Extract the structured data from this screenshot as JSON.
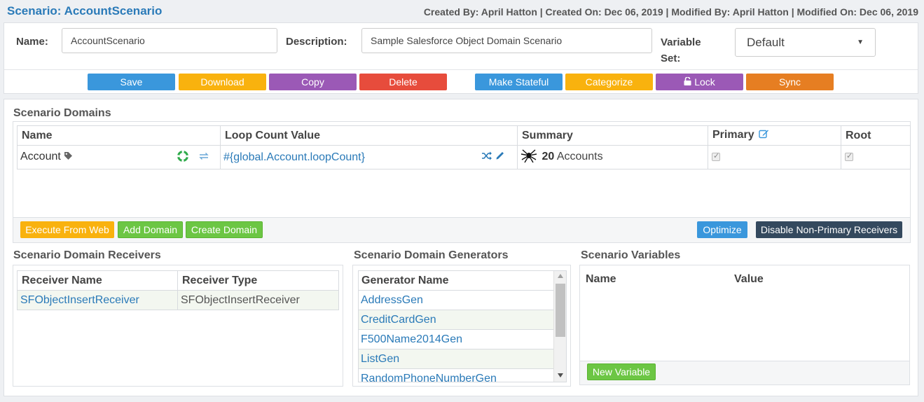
{
  "header": {
    "title": "Scenario: AccountScenario",
    "meta": "Created By: April Hatton | Created On: Dec 06, 2019 | Modified By: April Hatton | Modified On: Dec 06, 2019"
  },
  "form": {
    "name_label": "Name:",
    "name_value": "AccountScenario",
    "description_label": "Description:",
    "description_value": "Sample Salesforce Object Domain Scenario",
    "variable_set_label_1": "Variable",
    "variable_set_label_2": "Set:",
    "variable_set_value": "Default"
  },
  "toolbar": {
    "save": "Save",
    "download": "Download",
    "copy": "Copy",
    "delete": "Delete",
    "make_stateful": "Make Stateful",
    "categorize": "Categorize",
    "lock": "Lock",
    "sync": "Sync"
  },
  "domains": {
    "heading": "Scenario Domains",
    "columns": [
      "Name",
      "Loop Count Value",
      "Summary",
      "Primary",
      "Root"
    ],
    "row": {
      "name": "Account",
      "loop_count": "#{global.Account.loopCount}",
      "summary_count": "20",
      "summary_label": "Accounts"
    },
    "buttons": {
      "execute": "Execute From Web",
      "add_domain": "Add Domain",
      "create_domain": "Create Domain",
      "optimize": "Optimize",
      "disable_non_primary": "Disable Non-Primary Receivers"
    }
  },
  "receivers": {
    "heading": "Scenario Domain Receivers",
    "columns": [
      "Receiver Name",
      "Receiver Type"
    ],
    "rows": [
      {
        "name": "SFObjectInsertReceiver",
        "type": "SFObjectInsertReceiver"
      }
    ]
  },
  "generators": {
    "heading": "Scenario Domain Generators",
    "column": "Generator Name",
    "rows": [
      "AddressGen",
      "CreditCardGen",
      "F500Name2014Gen",
      "ListGen",
      "RandomPhoneNumberGen"
    ]
  },
  "variables": {
    "heading": "Scenario Variables",
    "columns": [
      "Name",
      "Value"
    ],
    "new_variable": "New Variable"
  },
  "colors": {
    "accent": "#2a7ab8",
    "blue": "#3a97dc",
    "yellow": "#f9b20e",
    "purple": "#9b59b6",
    "red": "#e74c3c",
    "orange": "#e67e22",
    "green": "#6cc644",
    "dark": "#34495e"
  }
}
